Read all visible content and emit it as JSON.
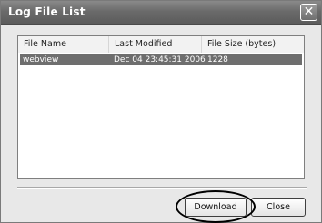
{
  "window": {
    "title": "Log File List",
    "close_glyph": "✕"
  },
  "list": {
    "columns": [
      "File Name",
      "Last Modified",
      "File Size (bytes)"
    ],
    "rows": [
      {
        "file_name": "webview",
        "last_modified": "Dec 04 23:45:31 2006",
        "size": "1228"
      }
    ]
  },
  "buttons": {
    "download": "Download",
    "close": "Close"
  },
  "icons": {
    "title_close": "close-icon"
  },
  "colors": {
    "selected_row": "#6e6e6e",
    "titlebar": "#6a6a6a"
  }
}
